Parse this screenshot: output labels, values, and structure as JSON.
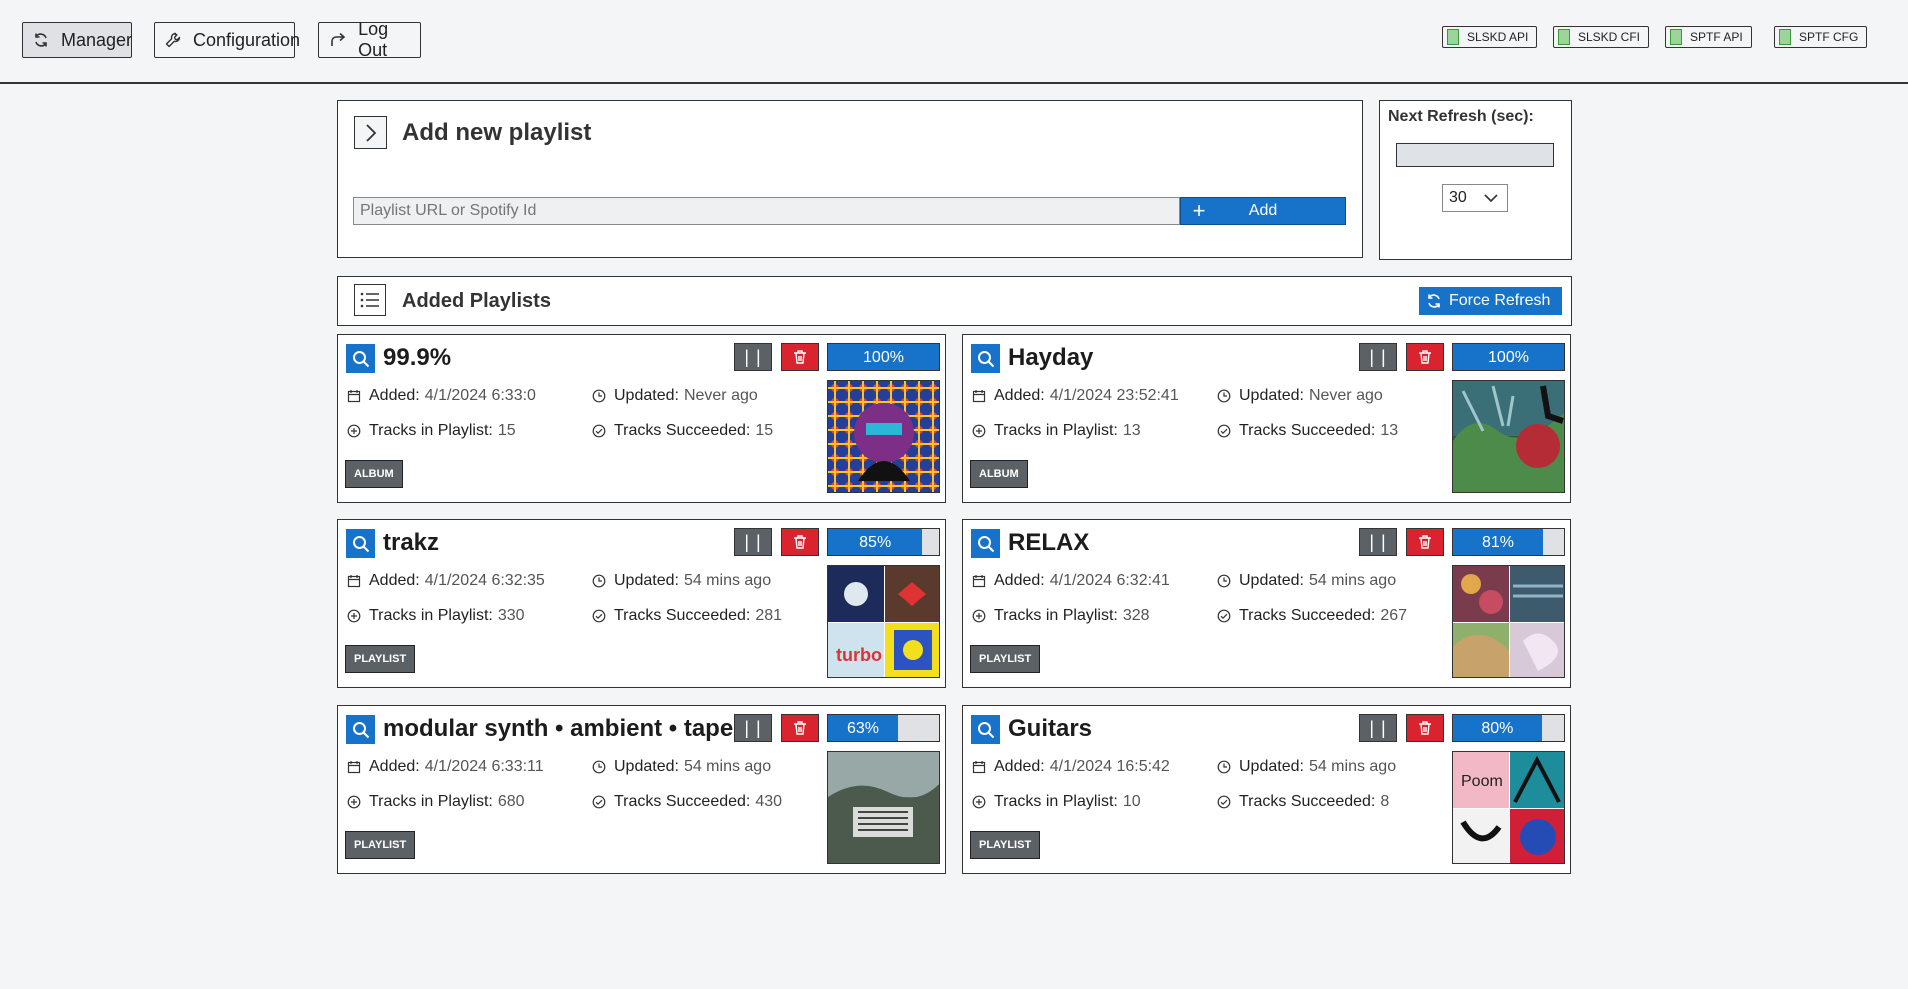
{
  "nav": {
    "manager": "Manager",
    "configuration": "Configuration",
    "logout": "Log Out"
  },
  "status_indicators": [
    "SLSKD API",
    "SLSKD CFI",
    "SPTF API",
    "SPTF CFG"
  ],
  "add_playlist": {
    "title": "Add new playlist",
    "placeholder": "Playlist URL or Spotify Id",
    "add_label": "Add"
  },
  "refresh": {
    "label": "Next Refresh (sec):",
    "interval": "30"
  },
  "added": {
    "title": "Added Playlists",
    "force_refresh": "Force Refresh"
  },
  "labels": {
    "added": "Added:",
    "updated": "Updated:",
    "tracks_in": "Tracks in Playlist:",
    "succeeded": "Tracks Succeeded:"
  },
  "colors": {
    "accent": "#1773c9",
    "danger": "#d9232f",
    "muted": "#5c6166"
  },
  "playlists": [
    {
      "name": "99.9%",
      "progress": "100%",
      "progress_value": 100,
      "added": "4/1/2024 6:33:0",
      "updated": "Never ago",
      "tracks": "15",
      "succeeded": "15",
      "type": "ALBUM"
    },
    {
      "name": "Hayday",
      "progress": "100%",
      "progress_value": 100,
      "added": "4/1/2024 23:52:41",
      "updated": "Never ago",
      "tracks": "13",
      "succeeded": "13",
      "type": "ALBUM"
    },
    {
      "name": "trakz",
      "progress": "85%",
      "progress_value": 85,
      "added": "4/1/2024 6:32:35",
      "updated": "54 mins ago",
      "tracks": "330",
      "succeeded": "281",
      "type": "PLAYLIST"
    },
    {
      "name": "RELAX",
      "progress": "81%",
      "progress_value": 81,
      "added": "4/1/2024 6:32:41",
      "updated": "54 mins ago",
      "tracks": "328",
      "succeeded": "267",
      "type": "PLAYLIST"
    },
    {
      "name": "modular synth • ambient • tape",
      "progress": "63%",
      "progress_value": 63,
      "added": "4/1/2024 6:33:11",
      "updated": "54 mins ago",
      "tracks": "680",
      "succeeded": "430",
      "type": "PLAYLIST"
    },
    {
      "name": "Guitars",
      "progress": "80%",
      "progress_value": 80,
      "added": "4/1/2024 16:5:42",
      "updated": "54 mins ago",
      "tracks": "10",
      "succeeded": "8",
      "type": "PLAYLIST"
    }
  ]
}
